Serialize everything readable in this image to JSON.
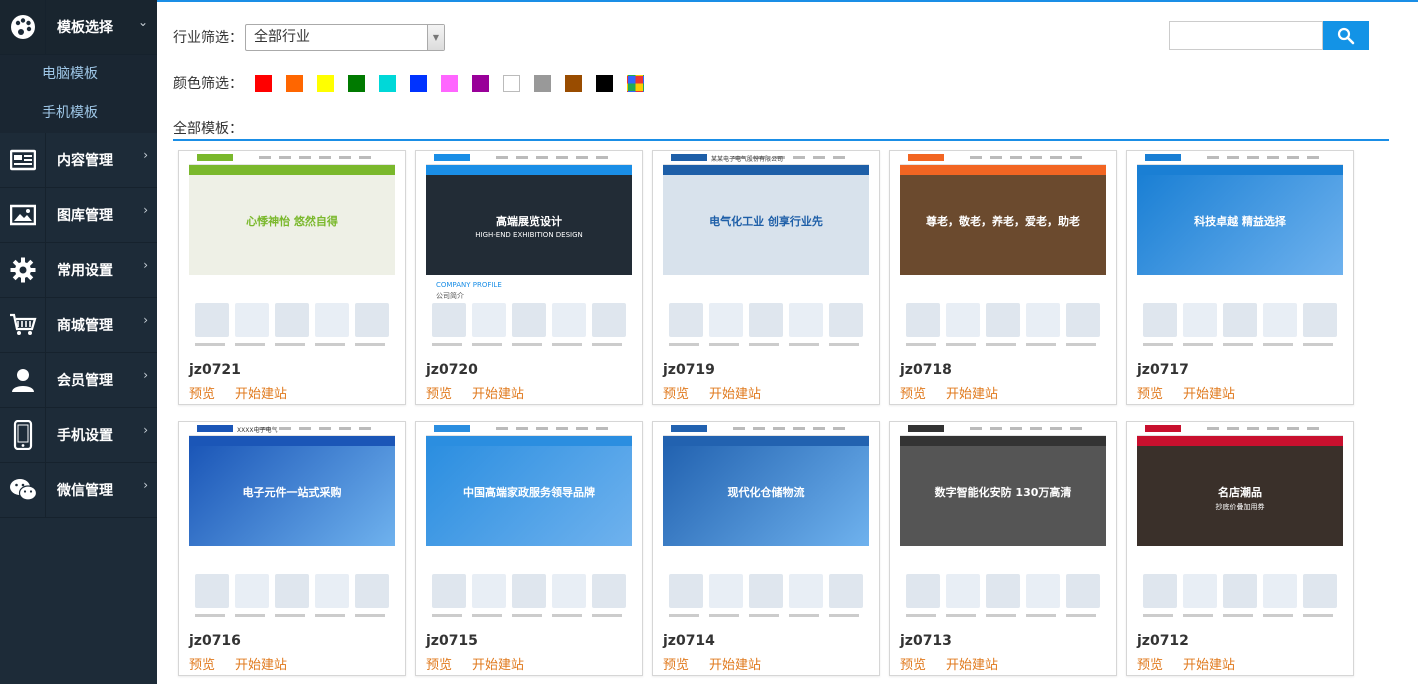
{
  "sidebar": {
    "items": [
      {
        "key": "template",
        "label": "模板选择",
        "icon": "palette-icon",
        "arrow": "chevron-down-icon"
      },
      {
        "key": "content",
        "label": "内容管理",
        "icon": "newspaper-icon",
        "arrow": "chevron-right-icon"
      },
      {
        "key": "gallery",
        "label": "图库管理",
        "icon": "image-icon",
        "arrow": "chevron-right-icon"
      },
      {
        "key": "settings",
        "label": "常用设置",
        "icon": "gear-icon",
        "arrow": "chevron-right-icon"
      },
      {
        "key": "shop",
        "label": "商城管理",
        "icon": "cart-icon",
        "arrow": "chevron-right-icon"
      },
      {
        "key": "member",
        "label": "会员管理",
        "icon": "user-icon",
        "arrow": "chevron-right-icon"
      },
      {
        "key": "mobile",
        "label": "手机设置",
        "icon": "phone-icon",
        "arrow": "chevron-right-icon"
      },
      {
        "key": "wechat",
        "label": "微信管理",
        "icon": "wechat-icon",
        "arrow": "chevron-right-icon"
      }
    ],
    "sub_items": [
      "电脑模板",
      "手机模板"
    ]
  },
  "filters": {
    "industry_label": "行业筛选：",
    "industry_selected": "全部行业",
    "color_label": "颜色筛选：",
    "colors": [
      "#ff0000",
      "#ff6600",
      "#ffff00",
      "#007a00",
      "#00d8d8",
      "#0033ff",
      "#ff66ff",
      "#990099",
      "#ffffff",
      "#999999",
      "#994c00",
      "#000000"
    ],
    "multi_color": "multicolor-swatch"
  },
  "search": {
    "placeholder": "",
    "icon": "search-icon"
  },
  "section_title": "全部模板：",
  "card_links": {
    "preview": "预览",
    "build": "开始建站"
  },
  "templates": [
    {
      "code": "jz0721",
      "banner_text": "心悸神怡 悠然自得",
      "theme": "#7ab82c"
    },
    {
      "code": "jz0720",
      "banner_text": "高端展览设计",
      "sub_text": "HIGH-END EXHIBITION DESIGN",
      "section": "COMPANY PROFILE",
      "section_cn": "公司简介",
      "theme": "#1a8ee6"
    },
    {
      "code": "jz0719",
      "banner_text": "电气化工业 创享行业先",
      "company": "某某电子电气股份有限公司",
      "theme": "#1e5fa8"
    },
    {
      "code": "jz0718",
      "banner_text": "尊老，敬老，养老，爱老，助老",
      "theme": "#f26522"
    },
    {
      "code": "jz0717",
      "banner_text": "科技卓越 精益选择",
      "theme": "#1a7fd4"
    },
    {
      "code": "jz0716",
      "company": "XXXX电子电气",
      "banner_text": "电子元件一站式采购",
      "theme": "#1b56b7"
    },
    {
      "code": "jz0715",
      "banner_text": "中国高端家政服务领导品牌",
      "theme": "#2b8ee0"
    },
    {
      "code": "jz0714",
      "banner_text": "现代化仓储物流",
      "theme": "#2262b0"
    },
    {
      "code": "jz0713",
      "banner_text": "数字智能化安防 130万高清",
      "theme": "#333333"
    },
    {
      "code": "jz0712",
      "banner_text": "名店潮品",
      "sub_text": "抄底价叠加用券",
      "theme": "#c8102e"
    }
  ]
}
